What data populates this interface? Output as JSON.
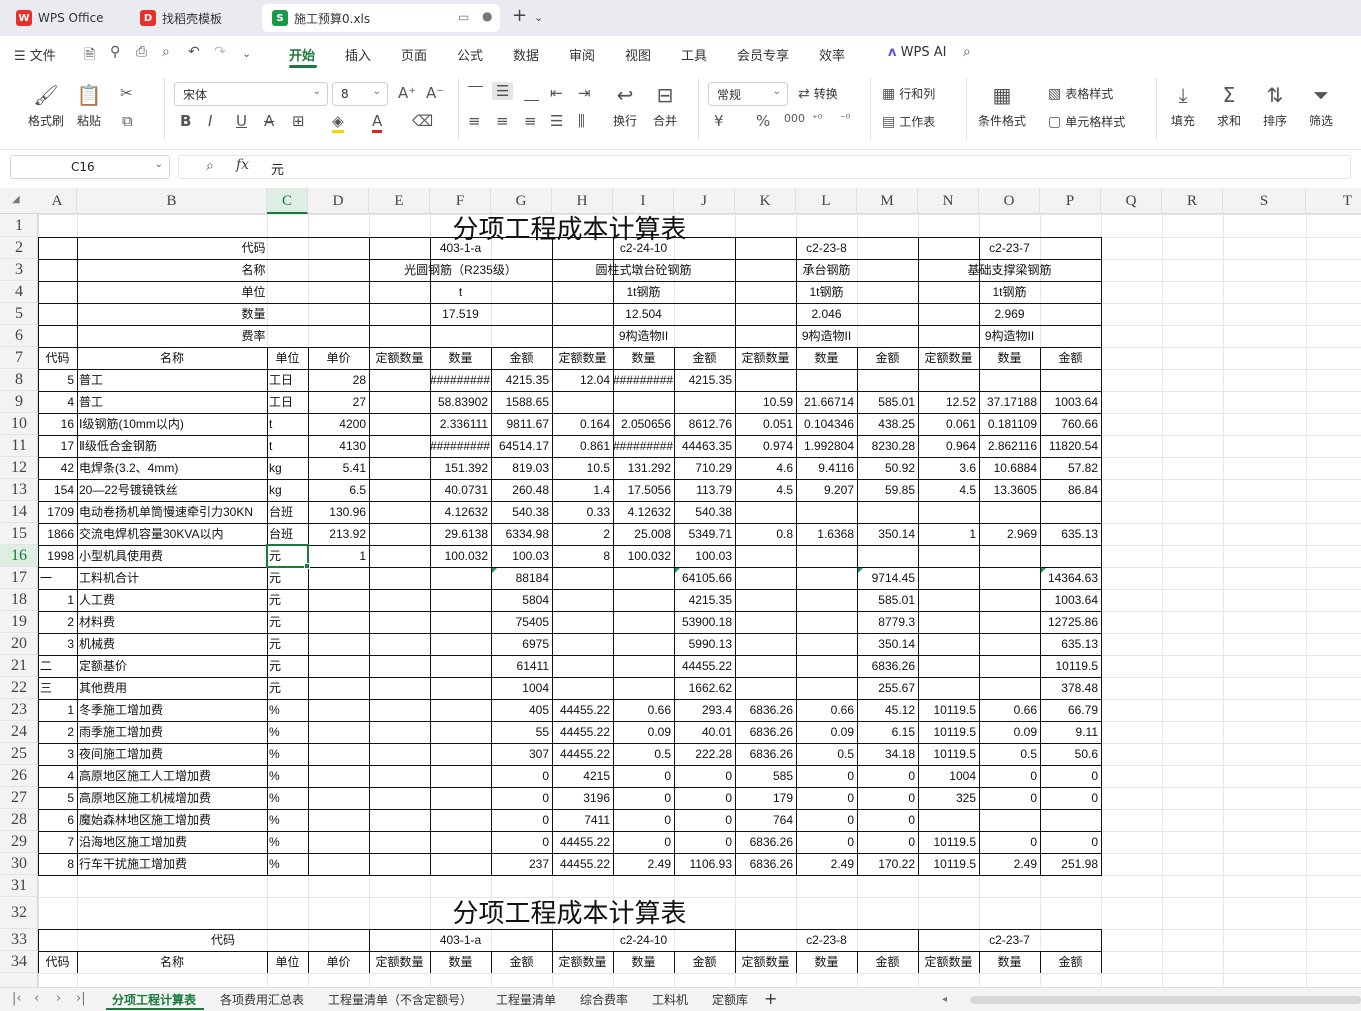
{
  "titlebar": {
    "tabs": [
      {
        "label": "WPS Office",
        "icon": "wps-logo-icon"
      },
      {
        "label": "找稻壳模板",
        "icon": "docer-icon"
      },
      {
        "label": "施工预算0.xls",
        "icon": "spreadsheet-icon"
      }
    ],
    "new_tab": "+"
  },
  "menubar": {
    "file": "文件",
    "items": [
      "开始",
      "插入",
      "页面",
      "公式",
      "数据",
      "审阅",
      "视图",
      "工具",
      "会员专享",
      "效率"
    ],
    "active": "开始",
    "wps_ai": "WPS AI"
  },
  "ribbon": {
    "format_painter": "格式刷",
    "paste": "粘贴",
    "font_name": "宋体",
    "font_size": "8",
    "wrap": "换行",
    "merge": "合并",
    "number_format": "常规",
    "convert": "转换",
    "row_col": "行和列",
    "worksheet": "工作表",
    "cond_format": "条件格式",
    "table_style": "表格样式",
    "cell_style": "单元格样式",
    "fill": "填充",
    "sum": "求和",
    "sort": "排序",
    "filter": "筛选",
    "currency": "¥",
    "percent": "%"
  },
  "formulabar": {
    "cell_ref": "C16",
    "fx": "fx",
    "content": "元"
  },
  "columns": [
    "A",
    "B",
    "C",
    "D",
    "E",
    "F",
    "G",
    "H",
    "I",
    "J",
    "K",
    "L",
    "M",
    "N",
    "O",
    "P",
    "Q",
    "R",
    "S",
    "T"
  ],
  "selected_column": "C",
  "selected_row": "16",
  "rows": [
    "1",
    "2",
    "3",
    "4",
    "5",
    "6",
    "7",
    "8",
    "9",
    "10",
    "11",
    "12",
    "13",
    "14",
    "15",
    "16",
    "17",
    "18",
    "19",
    "20",
    "21",
    "22",
    "23",
    "24",
    "25",
    "26",
    "27",
    "28",
    "29",
    "30",
    "31",
    "32",
    "33",
    "34"
  ],
  "sheet": {
    "title": "分项工程成本计算表",
    "header_labels": {
      "code": "代码",
      "name": "名称",
      "unit": "单位",
      "qty": "数量",
      "rate": "费率"
    },
    "items": [
      {
        "code": "403-1-a",
        "name": "光圆钢筋（R235级）",
        "unit": "t",
        "qty": "17.519",
        "rate": ""
      },
      {
        "code": "c2-24-10",
        "name": "圆柱式墩台砼钢筋",
        "unit": "1t钢筋",
        "qty": "12.504",
        "rate": "9构造物II"
      },
      {
        "code": "c2-23-8",
        "name": "承台钢筋",
        "unit": "1t钢筋",
        "qty": "2.046",
        "rate": "9构造物II"
      },
      {
        "code": "c2-23-7",
        "name": "基础支撑梁钢筋",
        "unit": "1t钢筋",
        "qty": "2.969",
        "rate": "9构造物II"
      }
    ],
    "col_headers": [
      "代码",
      "名称",
      "单位",
      "单价",
      "定额数量",
      "数量",
      "金额",
      "定额数量",
      "数量",
      "金额",
      "定额数量",
      "数量",
      "金额",
      "定额数量",
      "数量",
      "金额"
    ],
    "data_rows": [
      [
        "5",
        "普工",
        "工日",
        "28",
        "",
        "#########",
        "4215.35",
        "12.04",
        "#########",
        "4215.35",
        "",
        "",
        "",
        "",
        "",
        ""
      ],
      [
        "4",
        "普工",
        "工日",
        "27",
        "",
        "58.83902",
        "1588.65",
        "",
        "",
        "",
        "10.59",
        "21.66714",
        "585.01",
        "12.52",
        "37.17188",
        "1003.64"
      ],
      [
        "16",
        "Ⅰ级钢筋(10mm以内)",
        "t",
        "4200",
        "",
        "2.336111",
        "9811.67",
        "0.164",
        "2.050656",
        "8612.76",
        "0.051",
        "0.104346",
        "438.25",
        "0.061",
        "0.181109",
        "760.66"
      ],
      [
        "17",
        "Ⅱ级低合金钢筋",
        "t",
        "4130",
        "",
        "#########",
        "64514.17",
        "0.861",
        "#########",
        "44463.35",
        "0.974",
        "1.992804",
        "8230.28",
        "0.964",
        "2.862116",
        "11820.54"
      ],
      [
        "42",
        "电焊条(3.2、4mm)",
        "kg",
        "5.41",
        "",
        "151.392",
        "819.03",
        "10.5",
        "131.292",
        "710.29",
        "4.6",
        "9.4116",
        "50.92",
        "3.6",
        "10.6884",
        "57.82"
      ],
      [
        "154",
        "20—22号镀镜铁丝",
        "kg",
        "6.5",
        "",
        "40.0731",
        "260.48",
        "1.4",
        "17.5056",
        "113.79",
        "4.5",
        "9.207",
        "59.85",
        "4.5",
        "13.3605",
        "86.84"
      ],
      [
        "1709",
        "电动卷扬机单筒慢速牵引力30KN",
        "台班",
        "130.96",
        "",
        "4.12632",
        "540.38",
        "0.33",
        "4.12632",
        "540.38",
        "",
        "",
        "",
        "",
        "",
        ""
      ],
      [
        "1866",
        "交流电焊机容量30KVA以内",
        "台班",
        "213.92",
        "",
        "29.6138",
        "6334.98",
        "2",
        "25.008",
        "5349.71",
        "0.8",
        "1.6368",
        "350.14",
        "1",
        "2.969",
        "635.13"
      ],
      [
        "1998",
        "小型机具使用费",
        "元",
        "1",
        "",
        "100.032",
        "100.03",
        "8",
        "100.032",
        "100.03",
        "",
        "",
        "",
        "",
        "",
        ""
      ],
      [
        "一",
        "工料机合计",
        "元",
        "",
        "",
        "",
        "88184",
        "",
        "",
        "64105.66",
        "",
        "",
        "9714.45",
        "",
        "",
        "14364.63"
      ],
      [
        "1",
        "人工费",
        "元",
        "",
        "",
        "",
        "5804",
        "",
        "",
        "4215.35",
        "",
        "",
        "585.01",
        "",
        "",
        "1003.64"
      ],
      [
        "2",
        "材料费",
        "元",
        "",
        "",
        "",
        "75405",
        "",
        "",
        "53900.18",
        "",
        "",
        "8779.3",
        "",
        "",
        "12725.86"
      ],
      [
        "3",
        "机械费",
        "元",
        "",
        "",
        "",
        "6975",
        "",
        "",
        "5990.13",
        "",
        "",
        "350.14",
        "",
        "",
        "635.13"
      ],
      [
        "二",
        "定额基价",
        "元",
        "",
        "",
        "",
        "61411",
        "",
        "",
        "44455.22",
        "",
        "",
        "6836.26",
        "",
        "",
        "10119.5"
      ],
      [
        "三",
        "其他费用",
        "元",
        "",
        "",
        "",
        "1004",
        "",
        "",
        "1662.62",
        "",
        "",
        "255.67",
        "",
        "",
        "378.48"
      ],
      [
        "1",
        "冬季施工增加费",
        "%",
        "",
        "",
        "",
        "405",
        "44455.22",
        "0.66",
        "293.4",
        "6836.26",
        "0.66",
        "45.12",
        "10119.5",
        "0.66",
        "66.79"
      ],
      [
        "2",
        "雨季施工增加费",
        "%",
        "",
        "",
        "",
        "55",
        "44455.22",
        "0.09",
        "40.01",
        "6836.26",
        "0.09",
        "6.15",
        "10119.5",
        "0.09",
        "9.11"
      ],
      [
        "3",
        "夜间施工增加费",
        "%",
        "",
        "",
        "",
        "307",
        "44455.22",
        "0.5",
        "222.28",
        "6836.26",
        "0.5",
        "34.18",
        "10119.5",
        "0.5",
        "50.6"
      ],
      [
        "4",
        "高原地区施工人工增加费",
        "%",
        "",
        "",
        "",
        "0",
        "4215",
        "0",
        "0",
        "585",
        "0",
        "0",
        "1004",
        "0",
        "0"
      ],
      [
        "5",
        "高原地区施工机械增加费",
        "%",
        "",
        "",
        "",
        "0",
        "3196",
        "0",
        "0",
        "179",
        "0",
        "0",
        "325",
        "0",
        "0"
      ],
      [
        "6",
        "魔始森林地区施工增加费",
        "%",
        "",
        "",
        "",
        "0",
        "7411",
        "0",
        "0",
        "764",
        "0",
        "0",
        "",
        "",
        ""
      ],
      [
        "7",
        "沿海地区施工增加费",
        "%",
        "",
        "",
        "",
        "0",
        "44455.22",
        "0",
        "0",
        "6836.26",
        "0",
        "0",
        "10119.5",
        "0",
        "0"
      ],
      [
        "8",
        "行车干扰施工增加费",
        "%",
        "",
        "",
        "",
        "237",
        "44455.22",
        "2.49",
        "1106.93",
        "6836.26",
        "2.49",
        "170.22",
        "10119.5",
        "2.49",
        "251.98"
      ]
    ],
    "second_title": "分项工程成本计算表"
  },
  "sheet_tabs": [
    "分项工程计算表",
    "各项费用汇总表",
    "工程量清单（不含定额号）",
    "工程量清单",
    "综合费率",
    "工料机",
    "定额库"
  ],
  "active_sheet": "分项工程计算表",
  "colors": {
    "accent": "#1a7a3c",
    "selection_bg": "#dcefe2"
  }
}
